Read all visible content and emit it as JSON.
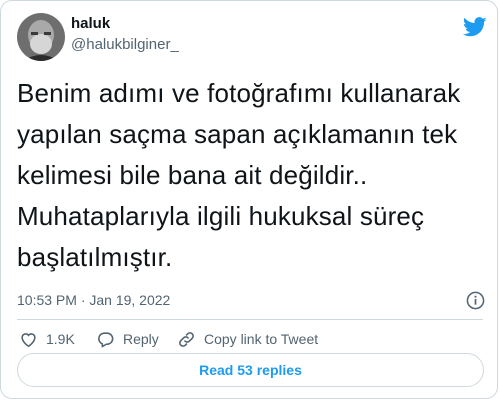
{
  "author": {
    "name": "haluk",
    "handle": "@halukbilginer_"
  },
  "tweet": {
    "text": "Benim adımı ve fotoğrafımı kullanarak\nyapılan saçma sapan açıklamanın tek\nkelimesi bile bana ait değildir..\nMuhataplarıyla ilgili hukuksal süreç\nbaşlatılmıştır.",
    "timestamp": "10:53 PM · Jan 19, 2022"
  },
  "actions": {
    "likes": "1.9K",
    "reply_label": "Reply",
    "copy_link_label": "Copy link to Tweet"
  },
  "replies_button": "Read 53 replies",
  "icons": [
    "profile-avatar",
    "twitter-bird-icon",
    "info-icon",
    "heart-icon",
    "reply-icon",
    "link-icon"
  ],
  "colors": {
    "accent": "#1d9bf0",
    "muted": "#536471",
    "text": "#0f1419",
    "border": "#cfd9de"
  }
}
